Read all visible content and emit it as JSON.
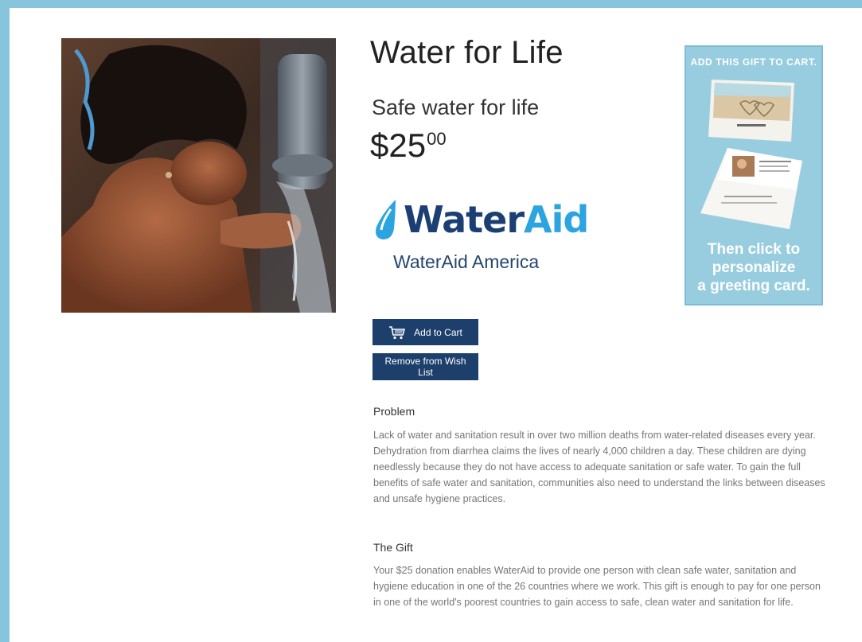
{
  "product": {
    "title": "Water for Life",
    "subtitle": "Safe water for life",
    "price_dollars": "$25",
    "price_cents": "00",
    "image_icon": "girl-drinking-water-photo"
  },
  "charity": {
    "logo_part1": "Water",
    "logo_part2": "Aid",
    "name": "WaterAid America",
    "logo_colors": {
      "dark": "#1b3f72",
      "light": "#2ca4e0"
    }
  },
  "promo": {
    "top_text": "ADD THIS GIFT TO CART.",
    "bottom_lines": [
      "Then click to",
      "personalize",
      "a greeting card."
    ]
  },
  "buttons": {
    "add_to_cart": "Add to Cart",
    "remove_wishlist": "Remove from Wish List",
    "cart_icon": "shopping-cart-icon"
  },
  "sections": {
    "problem": {
      "heading": "Problem",
      "text": "Lack of water and sanitation result in over two million deaths from water-related diseases every year. Dehydration from diarrhea claims the lives of nearly 4,000 children a day. These children are dying needlessly because they do not have access to adequate sanitation or safe water. To gain the full benefits of safe water and sanitation, communities also need to understand the links between diseases and unsafe hygiene practices."
    },
    "gift": {
      "heading": "The Gift",
      "text": "Your $25 donation enables WaterAid to provide one person with clean safe water, sanitation and hygiene education in one of the 26 countries where we work. This gift is enough to pay for one person in one of the world's poorest countries to gain access to safe, clean water and sanitation for life."
    }
  },
  "colors": {
    "frame": "#86c5dc",
    "button": "#1d3f6b",
    "promo_bg": "#98cde0"
  }
}
